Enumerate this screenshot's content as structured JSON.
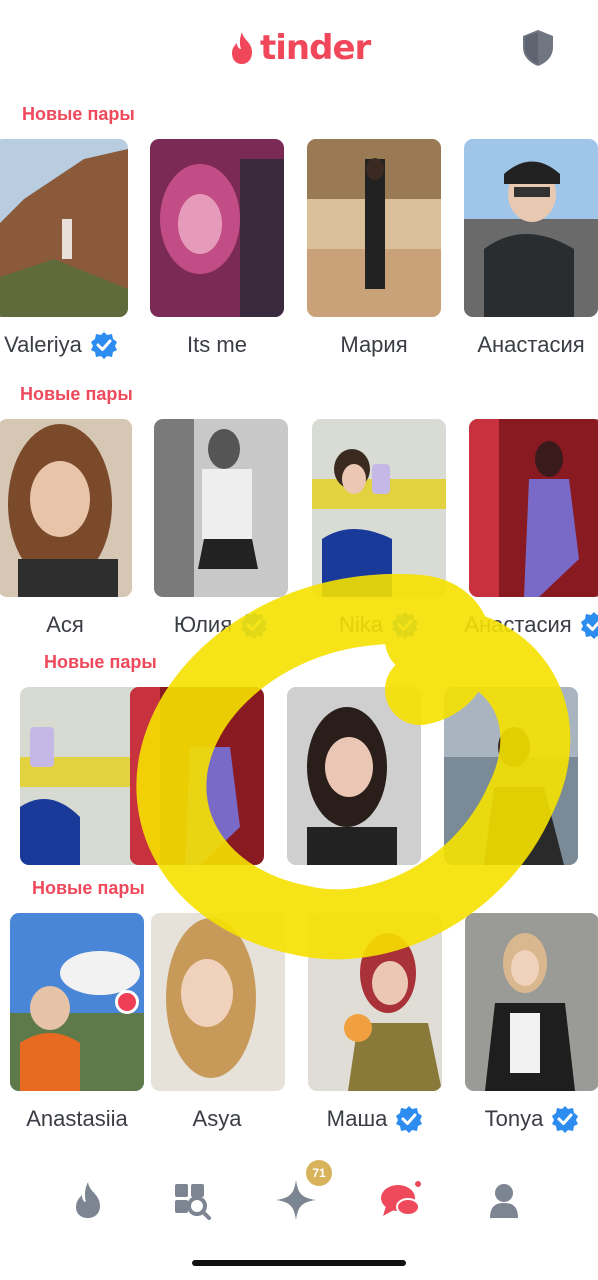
{
  "app": {
    "logo_text": "tinder",
    "brand_color": "#f0475a"
  },
  "sections": [
    {
      "title": "Новые пары",
      "cards": [
        {
          "name": "Valeriya",
          "verified": true
        },
        {
          "name": "Its me",
          "verified": false
        },
        {
          "name": "Мария",
          "verified": false
        },
        {
          "name": "Анастасия",
          "verified": false
        }
      ]
    },
    {
      "title": "Новые пары",
      "cards": [
        {
          "name": "Ася",
          "verified": false
        },
        {
          "name": "Юлия",
          "verified": true
        },
        {
          "name": "Nika",
          "verified": true
        },
        {
          "name": "Анастасия",
          "verified": true
        }
      ]
    },
    {
      "title": "Новые пары",
      "cards": [
        {
          "name": "",
          "verified": false
        },
        {
          "name": "",
          "verified": false
        },
        {
          "name": "",
          "verified": false
        },
        {
          "name": "",
          "verified": false
        }
      ]
    },
    {
      "title": "Новые пары",
      "cards": [
        {
          "name": "Anastasiia",
          "verified": false,
          "unread": true
        },
        {
          "name": "Asya",
          "verified": false
        },
        {
          "name": "Маша",
          "verified": true
        },
        {
          "name": "Tonya",
          "verified": true
        }
      ]
    }
  ],
  "navbar": {
    "items": [
      "flame-icon",
      "explore-icon",
      "gold-likes-icon",
      "messages-icon",
      "profile-icon"
    ],
    "likes_badge": "71",
    "active": "messages-icon"
  },
  "colors": {
    "accent": "#ef4a5c",
    "verified": "#2d8cf0",
    "badge": "#d9b35b",
    "inactive_icon": "#7c8591",
    "highlight": "#f5e100"
  }
}
